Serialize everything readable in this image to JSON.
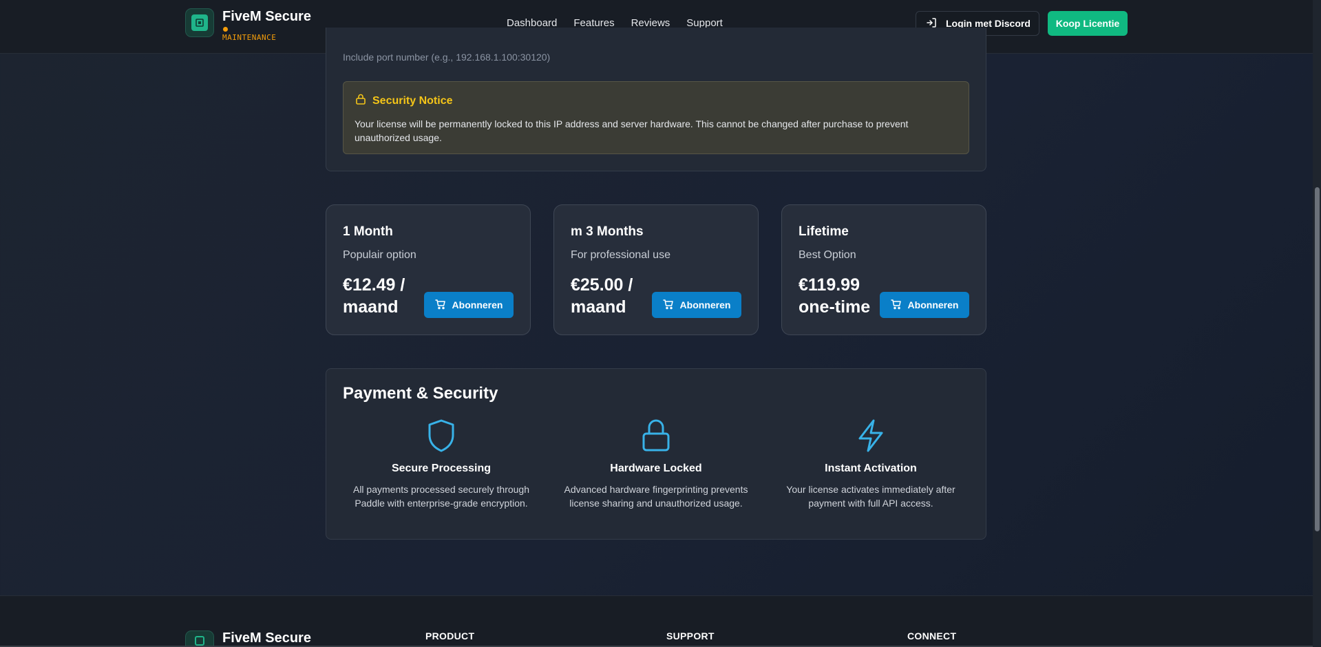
{
  "header": {
    "brand_name": "FiveM Secure",
    "status": "MAINTENANCE",
    "nav": [
      "Dashboard",
      "Features",
      "Reviews",
      "Support"
    ],
    "login_label": "Login met Discord",
    "buy_label": "Koop Licentie"
  },
  "ip_section": {
    "port_hint": "Include port number (e.g., 192.168.1.100:30120)",
    "notice_title": "Security Notice",
    "notice_text": "Your license will be permanently locked to this IP address and server hardware. This cannot be changed after purchase to prevent unauthorized usage."
  },
  "plans": [
    {
      "name": "1 Month",
      "subtitle": "Populair option",
      "price": "€12.49 / maand",
      "button": "Abonneren"
    },
    {
      "name": "m 3 Months",
      "subtitle": "For professional use",
      "price": "€25.00 / maand",
      "button": "Abonneren"
    },
    {
      "name": "Lifetime",
      "subtitle": "Best Option",
      "price": "€119.99 one-time",
      "button": "Abonneren"
    }
  ],
  "payment": {
    "title": "Payment & Security",
    "features": [
      {
        "icon": "shield-icon",
        "title": "Secure Processing",
        "desc": "All payments processed securely through Paddle with enterprise-grade encryption."
      },
      {
        "icon": "lock-icon",
        "title": "Hardware Locked",
        "desc": "Advanced hardware fingerprinting prevents license sharing and unauthorized usage."
      },
      {
        "icon": "lightning-icon",
        "title": "Instant Activation",
        "desc": "Your license activates immediately after payment with full API access."
      }
    ]
  },
  "footer": {
    "brand_name": "FiveM Secure",
    "columns": [
      "PRODUCT",
      "SUPPORT",
      "CONNECT"
    ]
  },
  "colors": {
    "accent_green": "#10b981",
    "accent_blue": "#0a7fc8",
    "warning": "#f59e0b",
    "notice_yellow": "#f5c518",
    "icon_blue": "#38b2e8"
  }
}
